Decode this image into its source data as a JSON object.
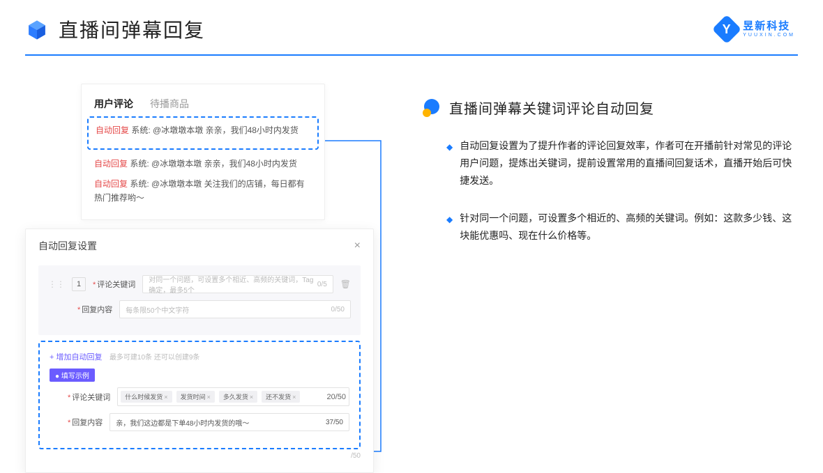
{
  "header": {
    "title": "直播间弹幕回复",
    "brand_cn": "昱新科技",
    "brand_en": "YUUXIN.COM"
  },
  "comments": {
    "tab_active": "用户评论",
    "tab_other": "待播商品",
    "line1_tag": "自动回复",
    "line1_sys": "系统:",
    "line1_txt": "@冰墩墩本墩 亲亲，我们48小时内发货",
    "line2_tag": "自动回复",
    "line2_sys": "系统:",
    "line2_txt": "@冰墩墩本墩 亲亲，我们48小时内发货",
    "line3_tag": "自动回复",
    "line3_sys": "系统:",
    "line3_txt": "@冰墩墩本墩 关注我们的店铺，每日都有热门推荐哟～"
  },
  "settings": {
    "title": "自动回复设置",
    "num": "1",
    "kw_label": "评论关键词",
    "kw_ph": "对同一个问题，可设置多个相近、高频的关键词，Tag确定，最多5个",
    "kw_cnt": "0/5",
    "rc_label": "回复内容",
    "rc_ph": "每条限50个中文字符",
    "rc_cnt": "0/50",
    "add": "+ 增加自动回复",
    "add_hint": "最多可建10条 还可以创建9条",
    "badge": "● 填写示例",
    "ex_kw_label": "评论关键词",
    "ex_kw_cnt": "20/50",
    "tags": [
      "什么时候发货",
      "发货时间",
      "多久发货",
      "还不发货"
    ],
    "ex_rc_label": "回复内容",
    "ex_rc_val": "亲，我们这边都是下单48小时内发货的哦～",
    "ex_rc_cnt": "37/50",
    "foot_cnt": "/50"
  },
  "right": {
    "title": "直播间弹幕关键词评论自动回复",
    "b1": "自动回复设置为了提升作者的评论回复效率，作者可在开播前针对常见的评论用户问题，提炼出关键词，提前设置常用的直播间回复话术，直播开始后可快捷发送。",
    "b2": "针对同一个问题，可设置多个相近的、高频的关键词。例如：这款多少钱、这块能优惠吗、现在什么价格等。"
  }
}
